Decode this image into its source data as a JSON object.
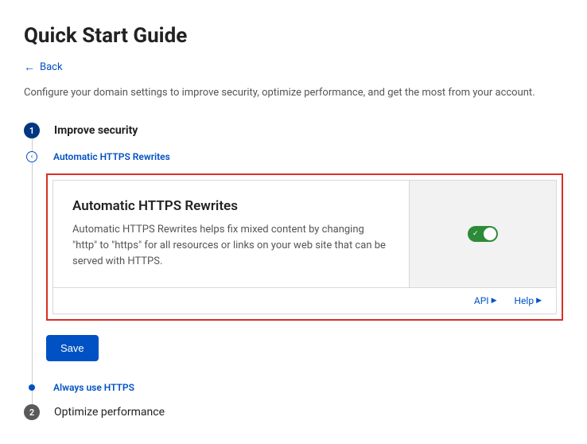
{
  "page": {
    "title": "Quick Start Guide",
    "back_label": "Back",
    "intro": "Configure your domain settings to improve security, optimize performance, and get the most from your account."
  },
  "steps": {
    "step1": {
      "num": "1",
      "label": "Improve security"
    },
    "step2": {
      "num": "2",
      "label": "Optimize performance"
    },
    "sub_https_rewrites": "Automatic HTTPS Rewrites",
    "sub_always_https": "Always use HTTPS"
  },
  "card": {
    "title": "Automatic HTTPS Rewrites",
    "desc": "Automatic HTTPS Rewrites helps fix mixed content by changing \"http\" to \"https\" for all resources or links on your web site that can be served with HTTPS.",
    "api_label": "API",
    "help_label": "Help",
    "toggle_on": true
  },
  "actions": {
    "save": "Save"
  }
}
